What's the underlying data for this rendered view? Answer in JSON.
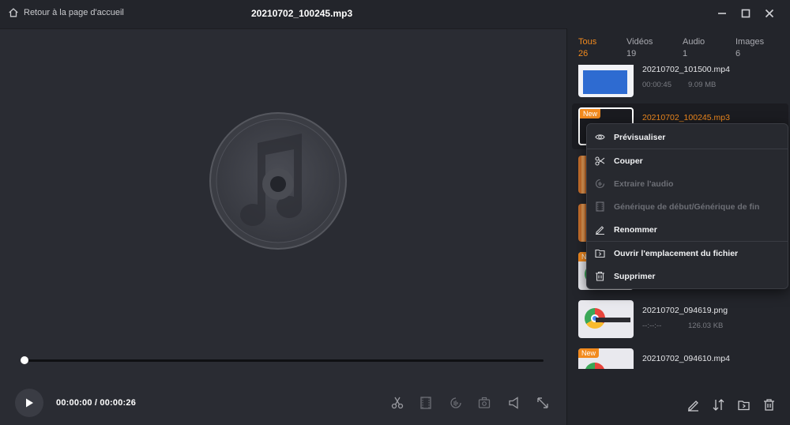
{
  "titlebar": {
    "home_label": "Retour à la page d'accueil",
    "file_title": "20210702_100245.mp3"
  },
  "player": {
    "timecode": "00:00:00 / 00:00:26",
    "progress": 0
  },
  "tabs": [
    {
      "label": "Tous",
      "count": "26",
      "active": true
    },
    {
      "label": "Vidéos",
      "count": "19",
      "active": false
    },
    {
      "label": "Audio",
      "count": "1",
      "active": false
    },
    {
      "label": "Images",
      "count": "6",
      "active": false
    }
  ],
  "files": [
    {
      "name": "20210702_101500.mp4",
      "duration": "00:00:45",
      "size": "9.09 MB",
      "new": false
    },
    {
      "name": "20210702_100245.mp3",
      "duration": "",
      "size": "",
      "new": true,
      "selected": true
    },
    {
      "name": "",
      "duration": "",
      "size": "",
      "new": false
    },
    {
      "name": "",
      "duration": "",
      "size": "",
      "new": false
    },
    {
      "name": "",
      "duration": "",
      "size": "",
      "new": true
    },
    {
      "name": "20210702_094619.png",
      "duration": "--:--:--",
      "size": "126.03 KB",
      "new": false
    },
    {
      "name": "20210702_094610.mp4",
      "duration": "",
      "size": "",
      "new": true
    }
  ],
  "badge_label": "New",
  "context_menu": {
    "items": [
      {
        "label": "Prévisualiser",
        "icon": "eye-icon",
        "disabled": false
      },
      {
        "label": "Couper",
        "icon": "scissors-icon",
        "disabled": false
      },
      {
        "label": "Extraire l'audio",
        "icon": "audio-extract-icon",
        "disabled": true
      },
      {
        "label": "Générique de début/Générique de fin",
        "icon": "film-icon",
        "disabled": true
      },
      {
        "label": "Renommer",
        "icon": "pen-icon",
        "disabled": false
      },
      {
        "label": "Ouvrir l'emplacement du fichier",
        "icon": "folder-icon",
        "disabled": false
      },
      {
        "label": "Supprimer",
        "icon": "trash-icon",
        "disabled": false
      }
    ]
  },
  "colors": {
    "accent": "#f28a1e",
    "background": "#23252b",
    "player_bg": "#2a2c33"
  }
}
